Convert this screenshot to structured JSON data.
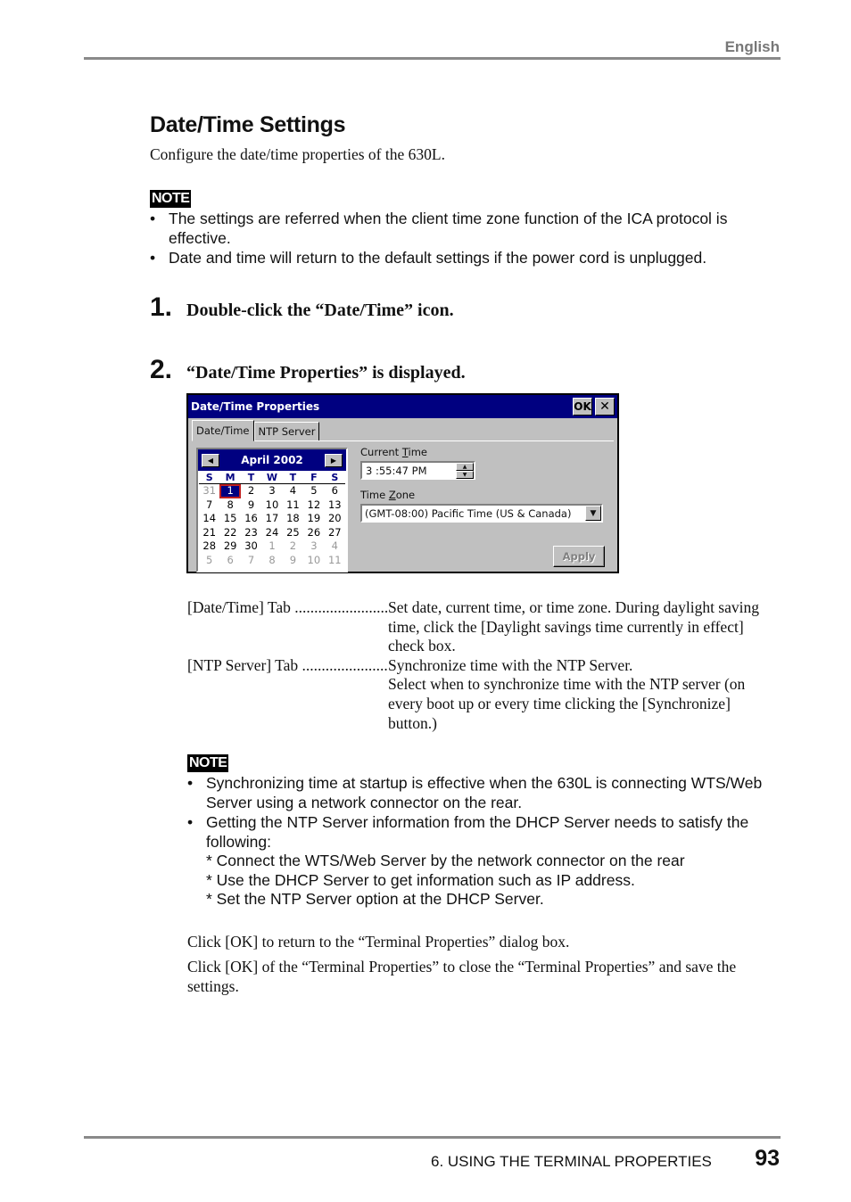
{
  "header": {
    "language": "English"
  },
  "section": {
    "title": "Date/Time Settings",
    "intro": "Configure the date/time properties of the 630L."
  },
  "note1": {
    "badge": "NOTE",
    "items": [
      "The settings are referred when the client time zone function of the ICA protocol is effective.",
      "Date and time will return to the default settings if the power cord is unplugged."
    ]
  },
  "steps": [
    {
      "number": "1.",
      "text": "Double-click the “Date/Time” icon."
    },
    {
      "number": "2.",
      "text": "“Date/Time Properties” is displayed."
    }
  ],
  "dialog": {
    "title": "Date/Time Properties",
    "ok_label": "OK",
    "close_label": "✕",
    "tabs": [
      {
        "label": "Date/Time",
        "active": true
      },
      {
        "label": "NTP Server",
        "active": false
      }
    ],
    "calendar": {
      "month_label": "April 2002",
      "prev_icon": "◀",
      "next_icon": "▶",
      "weekdays": [
        "S",
        "M",
        "T",
        "W",
        "T",
        "F",
        "S"
      ],
      "days": [
        {
          "d": "31",
          "dim": true
        },
        {
          "d": "1",
          "sel": true
        },
        {
          "d": "2"
        },
        {
          "d": "3"
        },
        {
          "d": "4"
        },
        {
          "d": "5"
        },
        {
          "d": "6"
        },
        {
          "d": "7"
        },
        {
          "d": "8"
        },
        {
          "d": "9"
        },
        {
          "d": "10"
        },
        {
          "d": "11"
        },
        {
          "d": "12"
        },
        {
          "d": "13"
        },
        {
          "d": "14"
        },
        {
          "d": "15"
        },
        {
          "d": "16"
        },
        {
          "d": "17"
        },
        {
          "d": "18"
        },
        {
          "d": "19"
        },
        {
          "d": "20"
        },
        {
          "d": "21"
        },
        {
          "d": "22"
        },
        {
          "d": "23"
        },
        {
          "d": "24"
        },
        {
          "d": "25"
        },
        {
          "d": "26"
        },
        {
          "d": "27"
        },
        {
          "d": "28"
        },
        {
          "d": "29"
        },
        {
          "d": "30"
        },
        {
          "d": "1",
          "dim": true
        },
        {
          "d": "2",
          "dim": true
        },
        {
          "d": "3",
          "dim": true
        },
        {
          "d": "4",
          "dim": true
        },
        {
          "d": "5",
          "dim": true
        },
        {
          "d": "6",
          "dim": true
        },
        {
          "d": "7",
          "dim": true
        },
        {
          "d": "8",
          "dim": true
        },
        {
          "d": "9",
          "dim": true
        },
        {
          "d": "10",
          "dim": true
        },
        {
          "d": "11",
          "dim": true
        }
      ]
    },
    "current_time_label_pre": "Current ",
    "current_time_label_u": "T",
    "current_time_label_post": "ime",
    "current_time_value": "3 :55:47 PM",
    "time_zone_label_pre": "Time ",
    "time_zone_label_u": "Z",
    "time_zone_label_post": "one",
    "time_zone_value": "(GMT-08:00) Pacific Time (US & Canada)",
    "apply_label": "Apply"
  },
  "descriptions": [
    {
      "term": "[Date/Time] Tab",
      "definition": "Set date, current time, or time zone.  During daylight saving time, click the [Daylight savings time currently in effect] check box."
    },
    {
      "term": "[NTP Server] Tab",
      "definition": "Synchronize time with the NTP Server.",
      "definition2": "Select when to synchronize time with the NTP server (on every boot up or every time clicking the [Synchronize] button.)"
    }
  ],
  "note2": {
    "badge": "NOTE",
    "item1": "Synchronizing time at startup is effective when the 630L is connecting WTS/Web Server using a network connector on the rear.",
    "item2": "Getting the NTP Server information from the DHCP Server needs to satisfy the following:",
    "subitems": [
      "* Connect the WTS/Web Server by the network connector on the rear",
      "* Use the DHCP Server to get information such as IP address.",
      "* Set the NTP Server option at the DHCP Server."
    ]
  },
  "closing": [
    "Click [OK] to return to the “Terminal Properties” dialog box.",
    "Click [OK] of the “Terminal Properties” to close the “Terminal Properties” and save the settings."
  ],
  "footer": {
    "section": "6. USING THE TERMINAL PROPERTIES",
    "page": "93"
  }
}
